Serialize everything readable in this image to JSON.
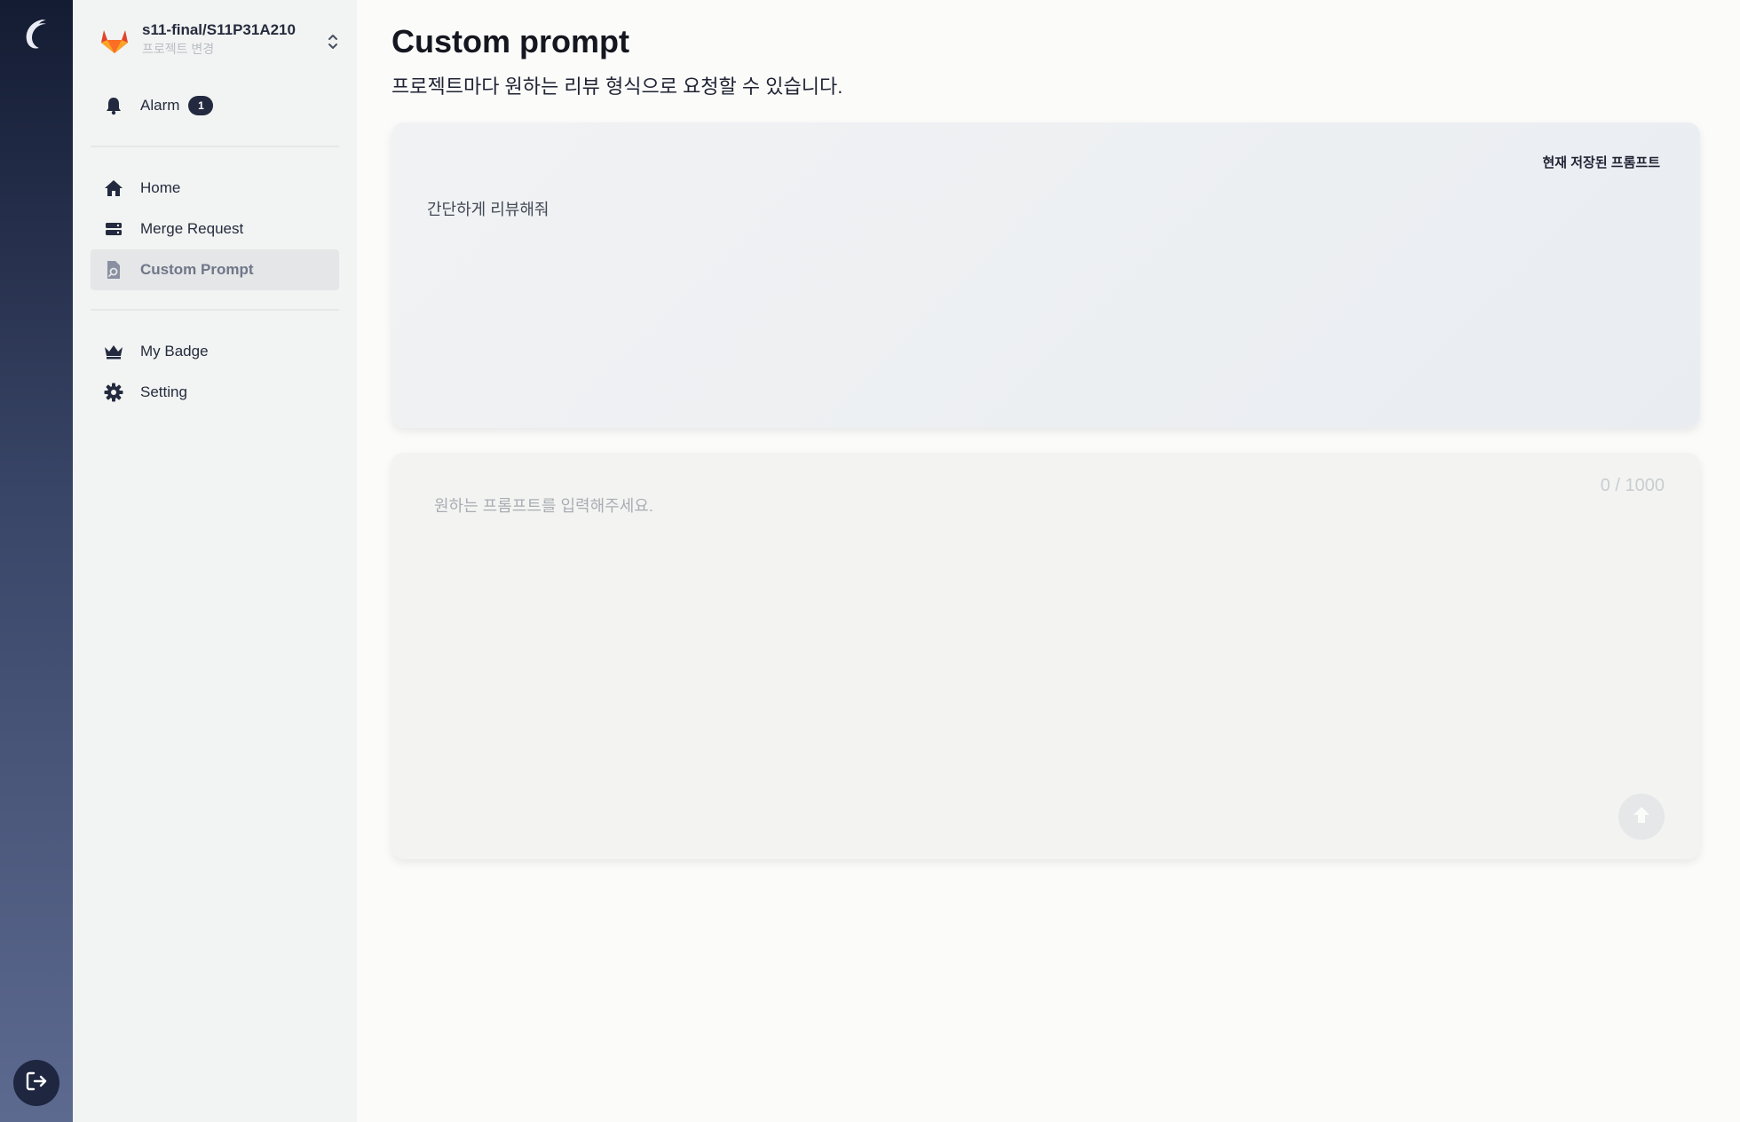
{
  "app": {
    "logo_icon": "app-logo-icon",
    "logout_icon": "logout-icon"
  },
  "project": {
    "name": "s11-final/S11P31A210",
    "change_label": "프로젝트 변경",
    "icon": "gitlab-fox-icon",
    "switch_icon": "chevron-up-down-icon"
  },
  "alarm": {
    "label": "Alarm",
    "count": "1",
    "icon": "bell-icon"
  },
  "nav": {
    "items": [
      {
        "label": "Home",
        "icon": "home-icon"
      },
      {
        "label": "Merge Request",
        "icon": "merge-request-icon"
      },
      {
        "label": "Custom Prompt",
        "icon": "custom-prompt-icon",
        "active": true
      }
    ],
    "secondary": [
      {
        "label": "My Badge",
        "icon": "crown-icon"
      },
      {
        "label": "Setting",
        "icon": "gear-icon"
      }
    ]
  },
  "page": {
    "title": "Custom prompt",
    "description": "프로젝트마다 원하는 리뷰 형식으로 요청할 수 있습니다."
  },
  "saved_prompt": {
    "label": "현재 저장된 프롬프트",
    "text": "간단하게 리뷰해줘"
  },
  "prompt_input": {
    "value": "",
    "placeholder": "원하는 프롬프트를 입력해주세요.",
    "counter": "0 / 1000",
    "submit_icon": "arrow-up-icon"
  },
  "colors": {
    "rail_top": "#141c33",
    "rail_bottom": "#5d6a90",
    "sidebar_bg": "#f2f4f3",
    "active_item_bg": "#e4e6e8",
    "badge_bg": "#232a40",
    "gitlab_orange": "#e2432a"
  }
}
